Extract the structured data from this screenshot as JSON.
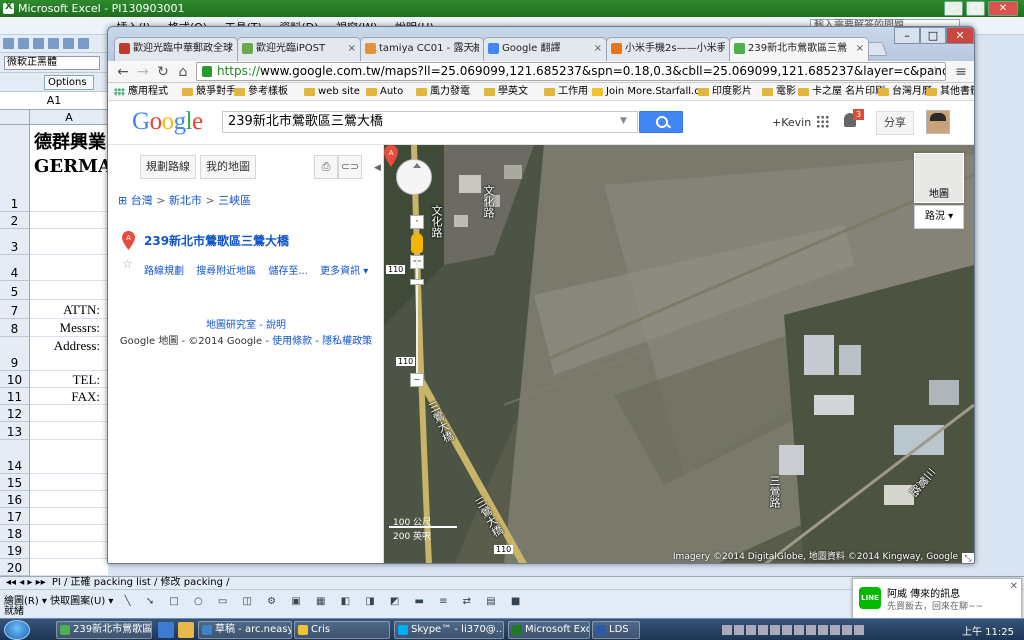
{
  "excel": {
    "title": "Microsoft Excel - PI130903001",
    "menu": [
      "檔案(F)",
      "編輯(E)",
      "檢視(V)",
      "插入(I)",
      "格式(O)",
      "工具(T)",
      "資料(D)",
      "視窗(W)",
      "說明(H)"
    ],
    "help_box": "輸入需要解答的問題",
    "font_box": "微軟正黑體",
    "options_label": "Options ▾",
    "name_box": "A1",
    "column_a": "A",
    "rows": [
      "1",
      "2",
      "3",
      "4",
      "5",
      "7",
      "8",
      "9",
      "10",
      "11",
      "12",
      "13",
      "14",
      "15",
      "16",
      "17",
      "18",
      "19",
      "20"
    ],
    "company_cn": "德群興業",
    "company_en": "GERMA",
    "labels": {
      "attn": "ATTN:",
      "messrs": "Messrs:",
      "address": "Address:",
      "tel": "TEL:",
      "fax": "FAX:"
    },
    "sheet_tabs": "PI / 正確 packing list / 修改 packing /",
    "draw_bar": "繪圖(R) ▾   快取圖案(U) ▾",
    "status": "就緒"
  },
  "chrome": {
    "tabs": [
      {
        "label": "歡迎光臨中華郵政全球",
        "color": "#c0392b"
      },
      {
        "label": "歡迎光臨iPOST",
        "color": "#6aa84f"
      },
      {
        "label": "tamiya CC01 - 露天拍",
        "color": "#e69138"
      },
      {
        "label": "Google 翻譯",
        "color": "#4285f4"
      },
      {
        "label": "小米手機2s——小米手",
        "color": "#e8751a"
      },
      {
        "label": "239新北市鶯歌區三鶯",
        "color": "#4caf50"
      }
    ],
    "url_scheme": "https://",
    "url_rest": "www.google.com.tw/maps?ll=25.069099,121.685237&spn=0.18,0.3&cbll=25.069099,121.685237&layer=c&panoid=iymDJ",
    "bookmarks": [
      "應用程式",
      "競爭對手",
      "參考樣板",
      "web site",
      "Auto",
      "風力發電",
      "學英文",
      "工作用",
      "Join More.Starfall.c",
      "印度影片",
      "電影",
      "卡之屋 名片印刷",
      "台灣月曆",
      "其他書籤"
    ]
  },
  "gmaps": {
    "logo_letters": [
      "G",
      "o",
      "o",
      "g",
      "l",
      "e"
    ],
    "logo_colors": [
      "#4285f4",
      "#ea4335",
      "#fbbc05",
      "#4285f4",
      "#34a853",
      "#ea4335"
    ],
    "search_value": "239新北市鶯歌區三鶯大橋",
    "user": "+Kevin",
    "notifications": "3",
    "share": "分享",
    "btn_directions": "規劃路線",
    "btn_my_maps": "我的地圖",
    "breadcrumb": [
      "台灣",
      "新北市",
      "三峽區"
    ],
    "place_title": "239新北市鶯歌區三鶯大橋",
    "actions": [
      "路線規劃",
      "搜尋附近地區",
      "儲存至...",
      "更多資訊 ▾"
    ],
    "lab_link": "地圖研究室 - 說明",
    "copyright_text": "Google 地圖  - ©2014 Google - ",
    "terms": "使用條款",
    "privacy": "隱私權政策",
    "map_type": "地圖",
    "traffic": "路況 ▾",
    "road_label_1": "文化路",
    "road_label_2": "文化路",
    "road_label_3": "三鶯大橋",
    "road_label_4": "三鶯大橋",
    "road_label_5": "三鶯路",
    "road_label_6": "三鶯路",
    "route_shield_1": "110",
    "route_shield_2": "110",
    "route_shield_3": "110",
    "scale_top": "100 公尺",
    "scale_bottom": "200 英呎",
    "attribution": "Imagery ©2014 DigitalGlobe, 地圖資料 ©2014 Kingway, Google"
  },
  "line": {
    "app": "LINE",
    "sender": "阿威 傳來的訊息",
    "message": "先買飯去，回來在聊~~"
  },
  "taskbar": {
    "items": [
      "239新北市鶯歌區...",
      "草稿 - arc.neasy...",
      "Cris",
      "Skype™ - li370@...",
      "Microsoft Excel ...",
      "LDS"
    ],
    "clock": "上午 11:25"
  }
}
